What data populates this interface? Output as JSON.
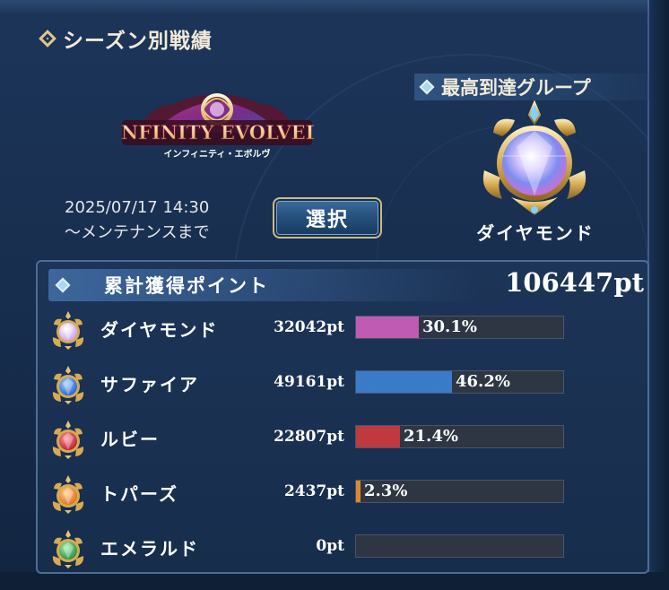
{
  "section": {
    "title": "シーズン別戦績"
  },
  "event": {
    "logo_main": "INFINITY EVOLVED",
    "logo_sub": "インフィニティ・エボルヴ",
    "date_line1": "2025/07/17 14:30",
    "date_line2": "〜メンテナンスまで",
    "select_label": "選択"
  },
  "best_group": {
    "header": "最高到達グループ",
    "name": "ダイヤモンド",
    "gem_icon": "diamond-gem-icon"
  },
  "points": {
    "header": "累計獲得ポイント",
    "total": "106447pt",
    "rows": [
      {
        "name": "ダイヤモンド",
        "points": "32042pt",
        "percent_label": "30.1%",
        "ratio": 0.301,
        "color": "#c75db8",
        "icon": "diamond-gem-icon"
      },
      {
        "name": "サファイア",
        "points": "49161pt",
        "percent_label": "46.2%",
        "ratio": 0.462,
        "color": "#3a7fd0",
        "icon": "sapphire-gem-icon"
      },
      {
        "name": "ルビー",
        "points": "22807pt",
        "percent_label": "21.4%",
        "ratio": 0.214,
        "color": "#c53a3f",
        "icon": "ruby-gem-icon"
      },
      {
        "name": "トパーズ",
        "points": "2437pt",
        "percent_label": "2.3%",
        "ratio": 0.023,
        "color": "#e88b2a",
        "icon": "topaz-gem-icon"
      },
      {
        "name": "エメラルド",
        "points": "0pt",
        "percent_label": "",
        "ratio": 0,
        "color": "#3fae5a",
        "icon": "emerald-gem-icon"
      }
    ]
  }
}
